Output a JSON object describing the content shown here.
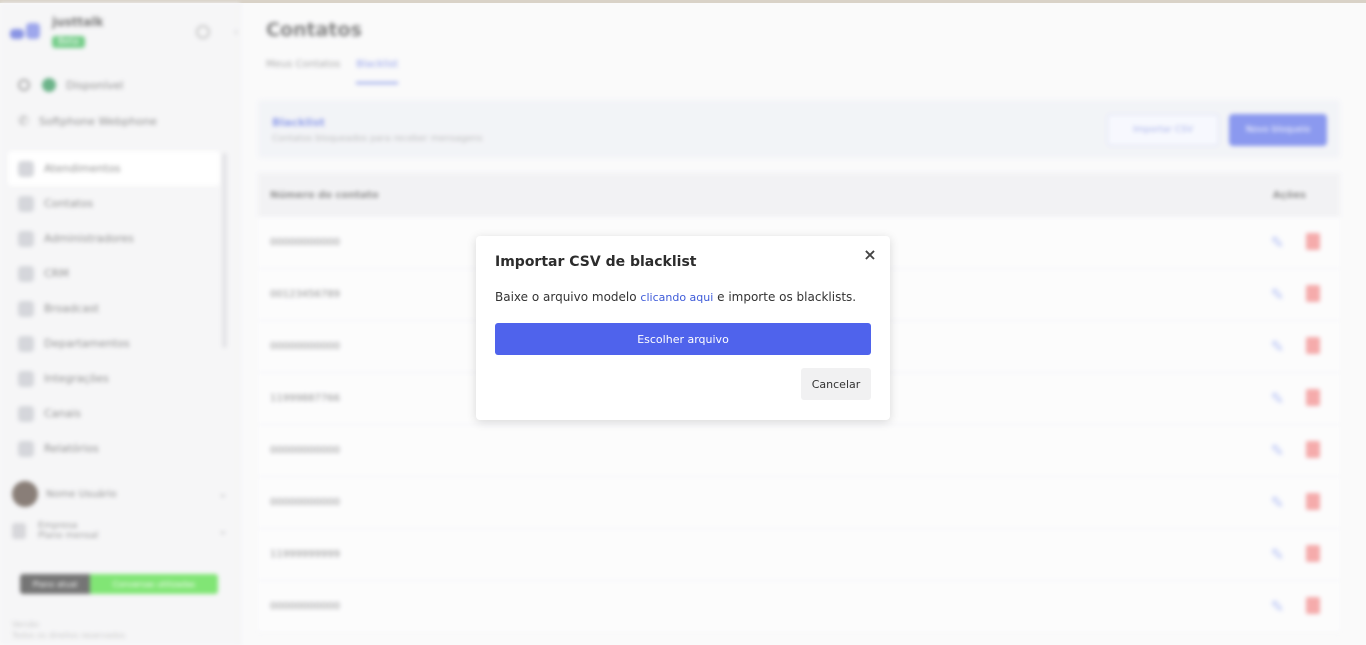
{
  "sidebar": {
    "brand_name": "justtalk",
    "brand_badge": "Beta",
    "status_label": "Disponível",
    "phone_label": "Softphone Webphone",
    "nav": [
      {
        "label": "Atendimentos",
        "icon": "chat-icon"
      },
      {
        "label": "Contatos",
        "icon": "contacts-icon"
      },
      {
        "label": "Administradores",
        "icon": "admin-icon"
      },
      {
        "label": "CRM",
        "icon": "crm-icon"
      },
      {
        "label": "Broadcast",
        "icon": "broadcast-icon"
      },
      {
        "label": "Departamentos",
        "icon": "departments-icon"
      },
      {
        "label": "Integrações",
        "icon": "integrations-icon"
      },
      {
        "label": "Canais",
        "icon": "channels-icon"
      },
      {
        "label": "Relatórios",
        "icon": "reports-icon"
      }
    ],
    "user_name": "Nome Usuário",
    "plan_line1": "Empresa",
    "plan_line2": "Plano mensal",
    "progress_left": "Plano atual",
    "progress_right": "Conversas utilizadas",
    "footer_line1": "Versão",
    "footer_line2": "Todos os direitos reservados"
  },
  "main": {
    "title": "Contatos",
    "tabs": [
      "Meus Contatos",
      "Blacklist"
    ],
    "card_title": "Blacklist",
    "card_sub": "Contatos bloqueados para receber mensagens",
    "import_button": "Importar CSV",
    "new_button": "Novo bloqueio",
    "col_number": "Número do contato",
    "col_actions": "Ações",
    "rows": [
      "00000000000",
      "00123456789",
      "00000000000",
      "11999887766",
      "00000000000",
      "00000000000",
      "11999999999",
      "00000000000"
    ]
  },
  "modal": {
    "title": "Importar CSV de blacklist",
    "text_before": "Baixe o arquivo modelo ",
    "link_text": "clicando aqui",
    "text_after": " e importe os blacklists.",
    "choose_button": "Escolher arquivo",
    "cancel_button": "Cancelar",
    "close_symbol": "×"
  }
}
